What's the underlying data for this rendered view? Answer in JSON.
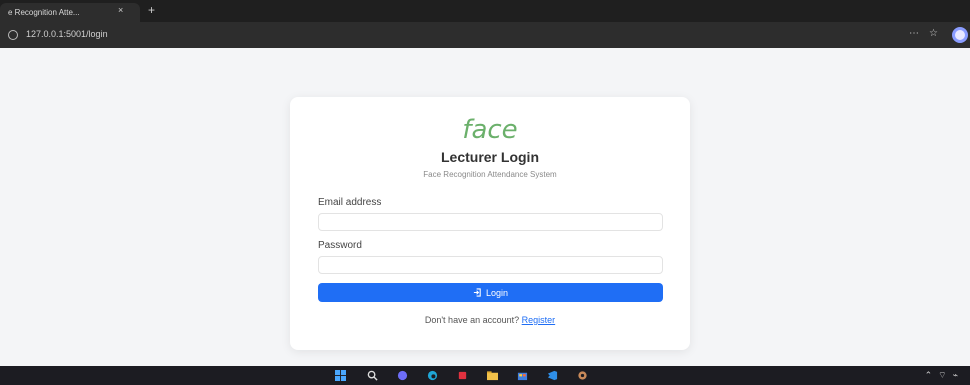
{
  "browser": {
    "tab_title": "e Recognition Atte...",
    "tab_close": "×",
    "new_tab": "+",
    "url": "127.0.0.1:5001/login"
  },
  "card": {
    "logo_text": "face",
    "title": "Lecturer Login",
    "subtitle": "Face Recognition Attendance System",
    "email_label": "Email address",
    "email_value": "",
    "password_label": "Password",
    "password_value": "",
    "login_button": "Login",
    "login_icon": "login-icon",
    "register_prompt": "Don't have an account?",
    "register_link": "Register"
  },
  "colors": {
    "primary": "#1f6ef5",
    "logo": "#6bb06b",
    "background": "#f4f5f7"
  }
}
